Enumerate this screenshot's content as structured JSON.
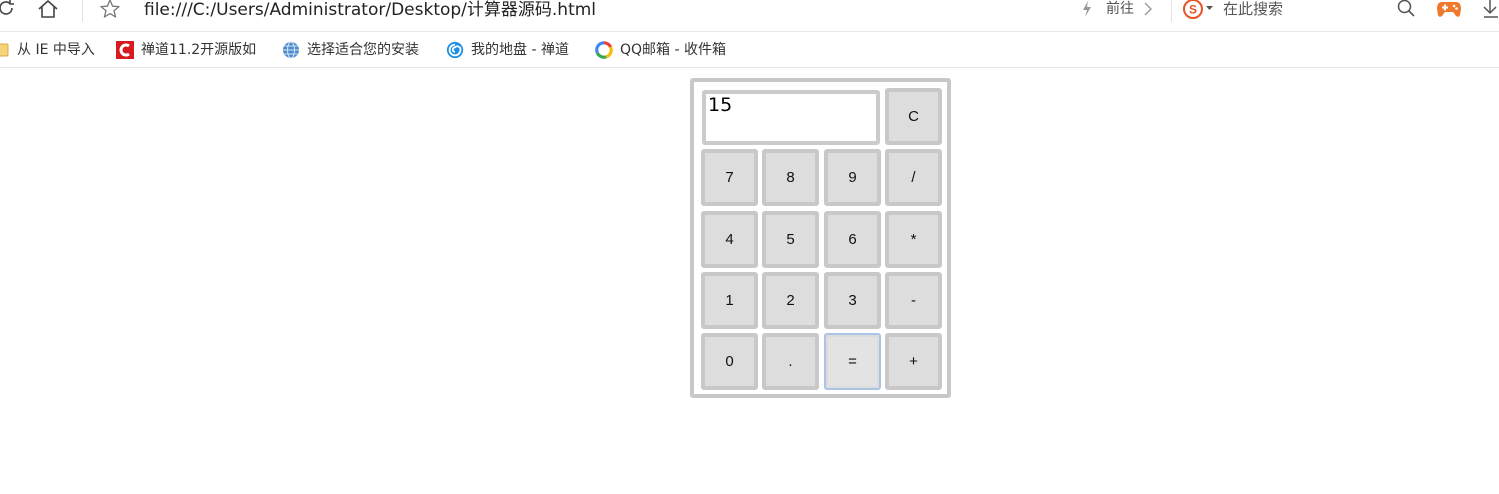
{
  "toolbar": {
    "url": "file:///C:/Users/Administrator/Desktop/计算器源码.html",
    "forward_label": "前往",
    "search_placeholder": "在此搜索"
  },
  "bookmarks": [
    {
      "label": "从 IE 中导入",
      "icon": "folder-icon"
    },
    {
      "label": "禅道11.2开源版如",
      "icon": "zentao-icon"
    },
    {
      "label": "选择适合您的安装",
      "icon": "globe-icon"
    },
    {
      "label": "我的地盘 - 禅道",
      "icon": "swirl-icon"
    },
    {
      "label": "QQ邮箱 - 收件箱",
      "icon": "qqmail-icon"
    }
  ],
  "calculator": {
    "display_value": "15",
    "clear_label": "C",
    "keys": [
      [
        "7",
        "8",
        "9",
        "/"
      ],
      [
        "4",
        "5",
        "6",
        "*"
      ],
      [
        "1",
        "2",
        "3",
        "-"
      ],
      [
        "0",
        ".",
        "=",
        "+"
      ]
    ]
  },
  "colors": {
    "key_bg": "#dddddd",
    "key_border": "#c8c8c8",
    "focus_border": "#a9c4e4"
  }
}
